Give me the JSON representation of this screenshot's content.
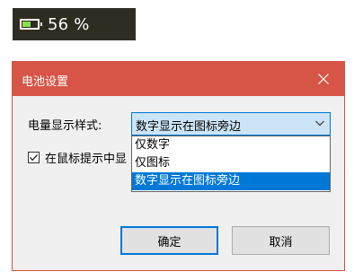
{
  "battery": {
    "icon": "battery-icon",
    "percent_text": "56 %",
    "level": 0.56,
    "fill_color": "#8be04e"
  },
  "dialog": {
    "title": "电池设置",
    "close_icon": "close-icon",
    "accent_color": "#d65546",
    "style_label": "电量显示样式:",
    "select": {
      "value": "数字显示在图标旁边",
      "options": [
        "仅数字",
        "仅图标",
        "数字显示在图标旁边"
      ],
      "highlighted_index": 2
    },
    "checkbox": {
      "checked": true,
      "label": "在鼠标提示中显"
    },
    "buttons": {
      "ok": "确定",
      "cancel": "取消"
    }
  }
}
